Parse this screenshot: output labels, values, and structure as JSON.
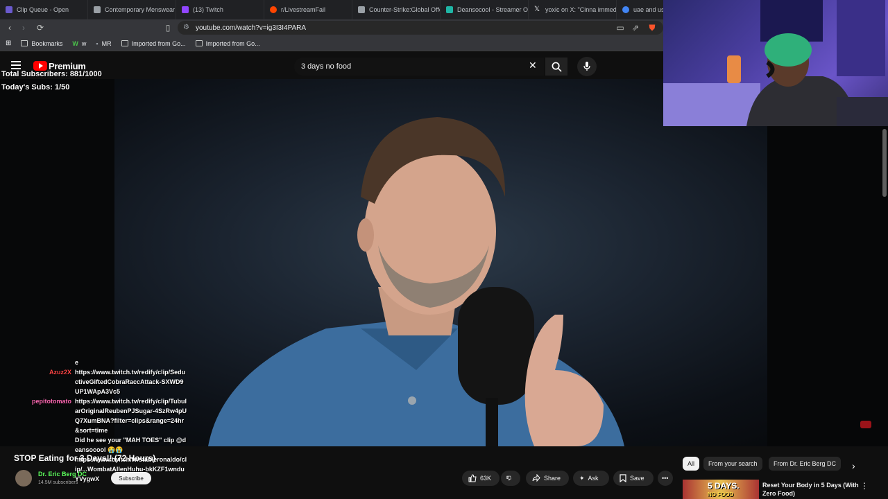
{
  "browser": {
    "tabs": [
      {
        "title": "Clip Queue - Open",
        "color": "#6a5acd"
      },
      {
        "title": "Contemporary Menswear",
        "color": "#9aa0a6"
      },
      {
        "title": "(13) Twitch",
        "color": "#9146ff"
      },
      {
        "title": "r/LivestreamFail",
        "color": "#ff4500"
      },
      {
        "title": "Counter-Strike:Global Offe...",
        "color": "#9aa0a6"
      },
      {
        "title": "Deansocool - Streamer Ov...",
        "color": "#1fb6a6"
      },
      {
        "title": "yoxic on X: \"Cinna immed...",
        "color": "#e8eaed"
      },
      {
        "title": "uae and us m...",
        "color": "#4285f4"
      }
    ],
    "url": "youtube.com/watch?v=ig3I3I4PARA",
    "bookmarks": [
      {
        "label": "Bookmarks"
      },
      {
        "label": "w"
      },
      {
        "label": "MR"
      },
      {
        "label": "Imported from Go..."
      },
      {
        "label": "Imported from Go..."
      }
    ]
  },
  "youtube": {
    "brand": "Premium",
    "search_query": "3 days no food",
    "video_title": "STOP Eating for 3 Days!! (72 Hours)",
    "channel_name": "Dr. Eric Berg DC",
    "channel_subs": "14.5M subscribers",
    "subscribe_label": "Subscribe",
    "likes": "63K",
    "share_label": "Share",
    "ask_label": "Ask",
    "save_label": "Save",
    "chips": [
      "All",
      "From your search",
      "From Dr. Eric Berg DC"
    ],
    "recommended": {
      "thumb_text": "5 DAYS.",
      "thumb_sub": "NO FOOD",
      "title": "Reset Your Body in 5 Days (With Zero Food)"
    }
  },
  "stream_overlay": {
    "total_subscribers": "Total Subscribers: 881/1000",
    "todays_subs": "Today's Subs: 1/50"
  },
  "chat": [
    {
      "user": "",
      "color": "#ffffff",
      "text": "e"
    },
    {
      "user": "Azuz2X",
      "color": "#ff4545",
      "text": "https://www.twitch.tv/redify/clip/SeductiveGiftedCobraRaccAttack-SXWD9UP1WApA3Vc5"
    },
    {
      "user": "pepitotomato",
      "color": "#ff69b4",
      "text": "https://www.twitch.tv/redify/clip/TubularOriginalReubenPJSugar-4SzRw4pUQ7XumBNA?filter=clips&range=24hr&sort=time"
    },
    {
      "user": "",
      "color": "#3a6cff",
      "text": "Did he see your \"MAH TOES\" clip @deansocool 😭😭"
    },
    {
      "user": "",
      "color": "#3a6cff",
      "text": "https://www.twitch.tv/stableronaldo/clip/...WombatAllenHuhu-bkKZF1wnduYVygwX"
    }
  ],
  "colors": {
    "youtube_red": "#ff0000",
    "page_bg": "#0f0f0f",
    "pill_bg": "#272727"
  }
}
